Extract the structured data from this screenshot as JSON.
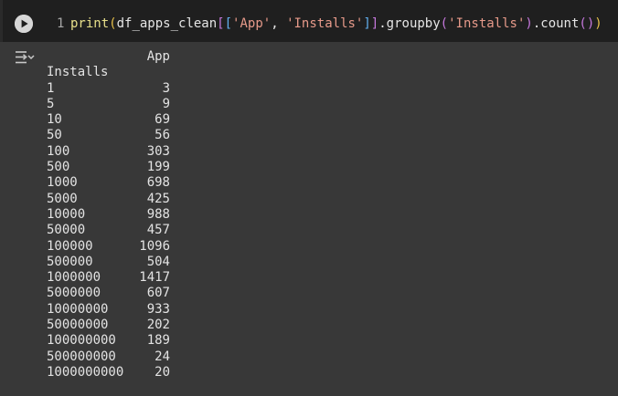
{
  "cell": {
    "line_number": "1",
    "code_tokens": [
      {
        "text": "print",
        "kind": "fn"
      },
      {
        "text": "(",
        "kind": "b1"
      },
      {
        "text": "df_apps_clean",
        "kind": "ident"
      },
      {
        "text": "[",
        "kind": "b2"
      },
      {
        "text": "[",
        "kind": "b3"
      },
      {
        "text": "'App'",
        "kind": "str"
      },
      {
        "text": ", ",
        "kind": "punc"
      },
      {
        "text": "'Installs'",
        "kind": "str"
      },
      {
        "text": "]",
        "kind": "b3"
      },
      {
        "text": "]",
        "kind": "b2"
      },
      {
        "text": ".groupby",
        "kind": "ident"
      },
      {
        "text": "(",
        "kind": "b2"
      },
      {
        "text": "'Installs'",
        "kind": "str"
      },
      {
        "text": ")",
        "kind": "b2"
      },
      {
        "text": ".count",
        "kind": "ident"
      },
      {
        "text": "()",
        "kind": "b2"
      },
      {
        "text": ")",
        "kind": "b1"
      }
    ]
  },
  "output": {
    "column_header": "App",
    "index_name": "Installs",
    "rows": [
      {
        "installs": "1",
        "app": "3"
      },
      {
        "installs": "5",
        "app": "9"
      },
      {
        "installs": "10",
        "app": "69"
      },
      {
        "installs": "50",
        "app": "56"
      },
      {
        "installs": "100",
        "app": "303"
      },
      {
        "installs": "500",
        "app": "199"
      },
      {
        "installs": "1000",
        "app": "698"
      },
      {
        "installs": "5000",
        "app": "425"
      },
      {
        "installs": "10000",
        "app": "988"
      },
      {
        "installs": "50000",
        "app": "457"
      },
      {
        "installs": "100000",
        "app": "1096"
      },
      {
        "installs": "500000",
        "app": "504"
      },
      {
        "installs": "1000000",
        "app": "1417"
      },
      {
        "installs": "5000000",
        "app": "607"
      },
      {
        "installs": "10000000",
        "app": "933"
      },
      {
        "installs": "50000000",
        "app": "202"
      },
      {
        "installs": "100000000",
        "app": "189"
      },
      {
        "installs": "500000000",
        "app": "24"
      },
      {
        "installs": "1000000000",
        "app": "20"
      }
    ]
  },
  "icons": {
    "run": "play-circle-icon",
    "output": "output-options-icon"
  },
  "colors": {
    "cell_background": "#1f1f1f",
    "output_background": "#383838",
    "text": "#e3e3e3"
  }
}
